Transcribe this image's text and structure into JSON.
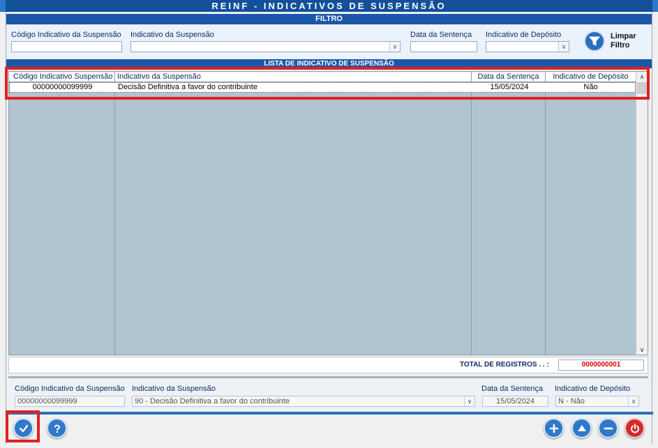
{
  "window": {
    "title": "REINF - INDICATIVOS DE SUSPENSÃO"
  },
  "filter": {
    "header": "FILTRO",
    "codigo_label": "Código Indicativo da Suspensão",
    "codigo_value": "",
    "indicativo_label": "Indicativo da Suspensão",
    "indicativo_value": "",
    "data_label": "Data da Sentença",
    "data_value": "",
    "deposito_label": "Indicativo de Depósito",
    "deposito_value": "",
    "clear_label_line1": "Limpar",
    "clear_label_line2": "Filtro"
  },
  "list": {
    "header": "LISTA DE INDICATIVO DE SUSPENSÃO",
    "columns": [
      "Código Indicativo Suspensão",
      "Indicativo da Suspensão",
      "Data da Sentença",
      "Indicativo de Depósito"
    ],
    "rows": [
      {
        "codigo": "00000000099999",
        "indicativo": "Decisão Definitiva a favor do contribuinte",
        "data": "15/05/2024",
        "deposito": "Não"
      }
    ]
  },
  "total": {
    "label": "TOTAL DE REGISTROS . . :",
    "value": "0000000001"
  },
  "detail": {
    "codigo_label": "Código Indicativo da Suspensão",
    "codigo_value": "00000000099999",
    "indicativo_label": "Indicativo da Suspensão",
    "indicativo_value": "90 - Decisão Definitiva a favor do contribuinte",
    "data_label": "Data da Sentença",
    "data_value": "15/05/2024",
    "deposito_label": "Indicativo de Depósito",
    "deposito_value": "N - Não"
  },
  "icons": {
    "confirm": "check-icon",
    "help": "question-icon",
    "add": "plus-icon",
    "edit": "triangle-up-icon",
    "remove": "minus-icon",
    "exit": "power-icon",
    "clear_filter": "funnel-icon"
  },
  "colors": {
    "title_bar": "#12509a",
    "section_bar": "#1a57a8",
    "grid_bg": "#b0c5cf",
    "total_value": "#d40000",
    "highlight": "#e02020"
  }
}
